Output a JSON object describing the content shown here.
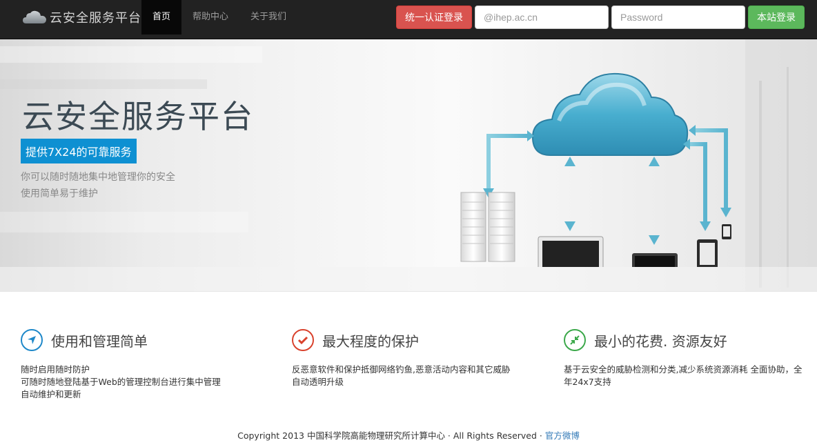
{
  "navbar": {
    "brand": "云安全服务平台",
    "nav_items": [
      "首页",
      "帮助中心",
      "关于我们"
    ],
    "unified_login_label": "统一认证登录",
    "username_placeholder": "@ihep.ac.cn",
    "password_placeholder": "Password",
    "local_login_label": "本站登录"
  },
  "hero": {
    "title": "云安全服务平台",
    "badge": "提供7X24的可靠服务",
    "desc_line1": "你可以随时随地集中地管理你的安全",
    "desc_line2": "使用简单易于维护"
  },
  "features": [
    {
      "icon": "navigation-arrow-icon",
      "color": "#1e88c9",
      "title": "使用和管理简单",
      "lines": [
        "随时启用随时防护",
        "可随时随地登陆基于Web的管理控制台进行集中管理",
        "自动维护和更新"
      ]
    },
    {
      "icon": "checkmark-icon",
      "color": "#d9412c",
      "title": "最大程度的保护",
      "lines": [
        "反恶意软件和保护抵御网络钓鱼,恶意活动内容和其它威胁",
        "自动透明升级"
      ]
    },
    {
      "icon": "compress-arrows-icon",
      "color": "#3ba84a",
      "title": "最小的花费. 资源友好",
      "lines": [
        "基于云安全的威胁检测和分类,减少系统资源消耗 全面协助，全",
        "年24x7支持"
      ]
    }
  ],
  "footer": {
    "copyright": "Copyright 2013 中国科学院高能物理研究所计算中心 · All Rights Reserved ·",
    "weibo_link": "官方微博"
  }
}
